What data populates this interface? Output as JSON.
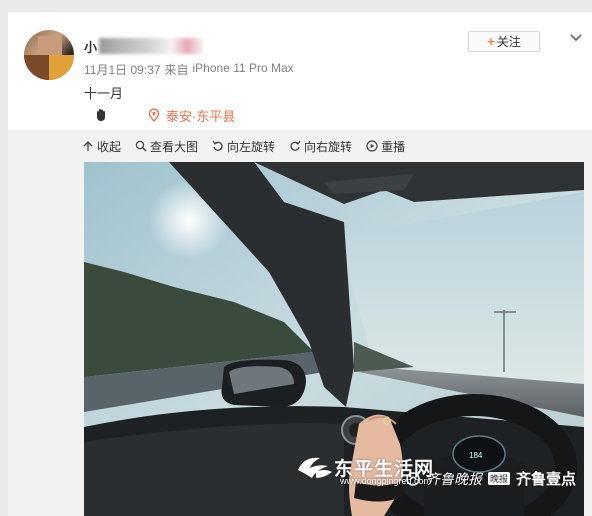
{
  "post": {
    "author_visible": "小",
    "follow_label": "关注",
    "timestamp": "11月1日 09:37",
    "source_prefix": "来自",
    "source_device": "iPhone 11 Pro Max",
    "text": "十一月",
    "location": "泰安·东平县"
  },
  "toolbar": {
    "collapse": "收起",
    "view_large": "查看大图",
    "rotate_left": "向左旋转",
    "rotate_right": "向右旋转",
    "replay": "重播"
  },
  "watermark": {
    "title": "东平生活网",
    "url": "www.dongpingren.com",
    "newspaper": "齐鲁晚报",
    "badge": "晚报",
    "brand": "齐鲁壹点"
  },
  "colors": {
    "location": "#eb7350",
    "follow_plus": "#ff8140"
  },
  "icons": [
    "more-chevron-icon",
    "hand-wave-icon",
    "location-pin-icon",
    "collapse-arrow-icon",
    "magnifier-icon",
    "rotate-left-icon",
    "rotate-right-icon",
    "replay-icon"
  ]
}
